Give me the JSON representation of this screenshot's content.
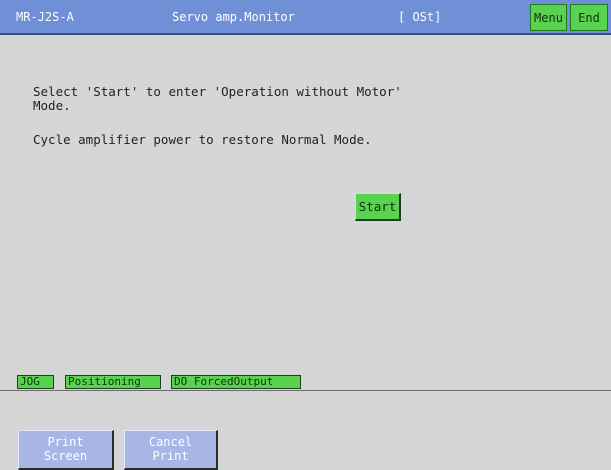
{
  "titlebar": {
    "model": "MR-J2S-A",
    "screen": "Servo amp.Monitor",
    "mode": "[ OSt]",
    "menu_label": "Menu",
    "end_label": "End"
  },
  "main": {
    "message_line1": "Select 'Start' to enter 'Operation without Motor'",
    "message_line2": "Mode.",
    "message_restore": "Cycle amplifier power to restore Normal Mode.",
    "start_label": "Start"
  },
  "tabs": [
    {
      "label": "JOG"
    },
    {
      "label": "Positioning"
    },
    {
      "label": "DO ForcedOutput"
    }
  ],
  "bottom": {
    "print_screen": [
      "Print",
      "Screen"
    ],
    "cancel_print": [
      "Cancel",
      "Print"
    ]
  },
  "colors": {
    "titlebar": "#6f8fd7",
    "green_button": "#58d24f",
    "blue_button": "#a8b6e6",
    "background": "#d6d6d6"
  }
}
